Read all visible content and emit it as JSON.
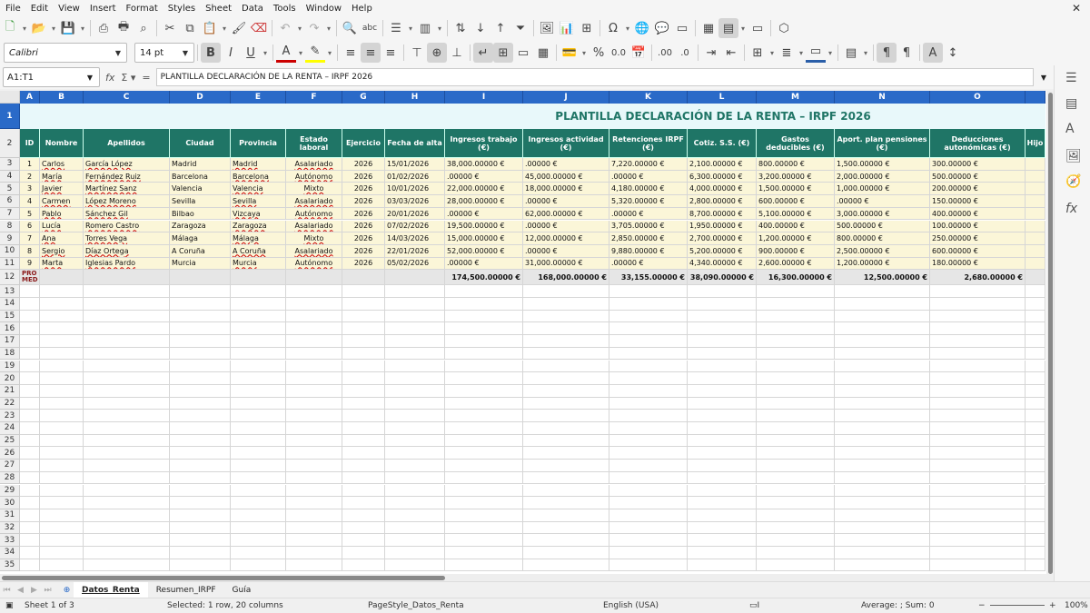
{
  "menu": [
    "File",
    "Edit",
    "View",
    "Insert",
    "Format",
    "Styles",
    "Sheet",
    "Data",
    "Tools",
    "Window",
    "Help"
  ],
  "toolbar": {
    "font_name": "Calibri",
    "font_size": "14 pt",
    "icons_row1": [
      "new-icon",
      "open-icon",
      "save-icon",
      "export-pdf-icon",
      "print-icon",
      "print-preview-icon",
      "cut-icon",
      "copy-icon",
      "paste-icon",
      "clone-format-icon",
      "clear-format-icon",
      "undo-icon",
      "redo-icon",
      "find-replace-icon",
      "spelling-icon",
      "row-icon",
      "column-icon",
      "sort-icon",
      "sort-ascending-icon",
      "sort-descending-icon",
      "autofilter-icon",
      "image-icon",
      "chart-icon",
      "pivot-table-icon",
      "special-character-icon",
      "hyperlink-icon",
      "comment-icon",
      "header-footer-icon",
      "define-print-area-icon",
      "freeze-icon",
      "split-window-icon",
      "show-draw-icon"
    ],
    "icons_row2": [
      "bold-icon",
      "italic-icon",
      "underline-icon",
      "font-color-icon",
      "highlight-icon",
      "align-left-icon",
      "align-center-icon",
      "align-right-icon",
      "align-top-icon",
      "align-middle-icon",
      "align-bottom-icon",
      "wrap-text-icon",
      "merge-center-icon",
      "merge-cells-icon",
      "unmerge-icon",
      "currency-icon",
      "percent-icon",
      "number-icon",
      "date-icon",
      "add-decimal-icon",
      "delete-decimal-icon",
      "increase-indent-icon",
      "decrease-indent-icon",
      "borders-icon",
      "border-style-icon",
      "border-color-icon",
      "conditional-icon",
      "ltr-icon",
      "rtl-icon",
      "vertical-text-icon",
      "text-direction-icon"
    ]
  },
  "formula_bar": {
    "name_box": "A1:T1",
    "content": "PLANTILLA DECLARACIÓN DE LA RENTA – IRPF 2026"
  },
  "columns": [
    "A",
    "B",
    "C",
    "D",
    "E",
    "F",
    "G",
    "H",
    "I",
    "J",
    "K",
    "L",
    "M",
    "N",
    "O"
  ],
  "title": "PLANTILLA DECLARACIÓN DE LA RENTA – IRPF 2026",
  "headers": [
    "ID",
    "Nombre",
    "Apellidos",
    "Ciudad",
    "Provincia",
    "Estado laboral",
    "Ejercicio",
    "Fecha de alta",
    "Ingresos trabajo (€)",
    "Ingresos actividad (€)",
    "Retenciones IRPF (€)",
    "Cotiz. S.S. (€)",
    "Gastos deducibles (€)",
    "Aport. plan pensiones (€)",
    "Deducciones autonómicas (€)",
    "Hijo"
  ],
  "rows": [
    [
      "1",
      "Carlos",
      "García López",
      "Madrid",
      "Madrid",
      "Asalariado",
      "2026",
      "15/01/2026",
      "38,000.00000 €",
      ".00000 €",
      "7,220.00000 €",
      "2,100.00000 €",
      "800.00000 €",
      "1,500.00000 €",
      "300.00000 €"
    ],
    [
      "2",
      "María",
      "Fernández Ruiz",
      "Barcelona",
      "Barcelona",
      "Autónomo",
      "2026",
      "01/02/2026",
      ".00000 €",
      "45,000.00000 €",
      ".00000 €",
      "6,300.00000 €",
      "3,200.00000 €",
      "2,000.00000 €",
      "500.00000 €"
    ],
    [
      "3",
      "Javier",
      "Martínez Sanz",
      "Valencia",
      "Valencia",
      "Mixto",
      "2026",
      "10/01/2026",
      "22,000.00000 €",
      "18,000.00000 €",
      "4,180.00000 €",
      "4,000.00000 €",
      "1,500.00000 €",
      "1,000.00000 €",
      "200.00000 €"
    ],
    [
      "4",
      "Carmen",
      "López Moreno",
      "Sevilla",
      "Sevilla",
      "Asalariado",
      "2026",
      "03/03/2026",
      "28,000.00000 €",
      ".00000 €",
      "5,320.00000 €",
      "2,800.00000 €",
      "600.00000 €",
      ".00000 €",
      "150.00000 €"
    ],
    [
      "5",
      "Pablo",
      "Sánchez Gil",
      "Bilbao",
      "Vizcaya",
      "Autónomo",
      "2026",
      "20/01/2026",
      ".00000 €",
      "62,000.00000 €",
      ".00000 €",
      "8,700.00000 €",
      "5,100.00000 €",
      "3,000.00000 €",
      "400.00000 €"
    ],
    [
      "6",
      "Lucía",
      "Romero Castro",
      "Zaragoza",
      "Zaragoza",
      "Asalariado",
      "2026",
      "07/02/2026",
      "19,500.00000 €",
      ".00000 €",
      "3,705.00000 €",
      "1,950.00000 €",
      "400.00000 €",
      "500.00000 €",
      "100.00000 €"
    ],
    [
      "7",
      "Ana",
      "Torres Vega",
      "Málaga",
      "Málaga",
      "Mixto",
      "2026",
      "14/03/2026",
      "15,000.00000 €",
      "12,000.00000 €",
      "2,850.00000 €",
      "2,700.00000 €",
      "1,200.00000 €",
      "800.00000 €",
      "250.00000 €"
    ],
    [
      "8",
      "Sergio",
      "Díaz Ortega",
      "A Coruña",
      "A Coruña",
      "Asalariado",
      "2026",
      "22/01/2026",
      "52,000.00000 €",
      ".00000 €",
      "9,880.00000 €",
      "5,200.00000 €",
      "900.00000 €",
      "2,500.00000 €",
      "600.00000 €"
    ],
    [
      "9",
      "Marta",
      "Iglesias Pardo",
      "Murcia",
      "Murcia",
      "Autónomo",
      "2026",
      "05/02/2026",
      ".00000 €",
      "31,000.00000 €",
      ".00000 €",
      "4,340.00000 €",
      "2,600.00000 €",
      "1,200.00000 €",
      "180.00000 €"
    ]
  ],
  "totals": {
    "label": "PRO MED",
    "values": [
      "174,500.00000 €",
      "168,000.00000 €",
      "33,155.00000 €",
      "38,090.00000 €",
      "16,300.00000 €",
      "12,500.00000 €",
      "2,680.00000 €"
    ]
  },
  "sheet_tabs": [
    "Datos_Renta",
    "Resumen_IRPF",
    "Guía"
  ],
  "active_tab": "Datos_Renta",
  "status": {
    "sheet": "Sheet 1 of 3",
    "selection": "Selected: 1 row, 20 columns",
    "page_style": "PageStyle_Datos_Renta",
    "language": "English (USA)",
    "summary": "Average: ; Sum: 0",
    "zoom": "100%"
  },
  "colors": {
    "header_bg": "#1f7566",
    "title_text": "#1f7566",
    "data_bg": "#fbf6d8",
    "selection": "#2a6ac8"
  }
}
